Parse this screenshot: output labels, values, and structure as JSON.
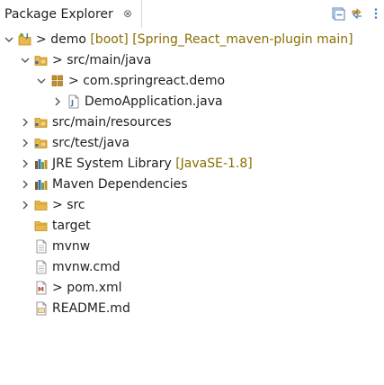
{
  "view": {
    "title": "Package Explorer",
    "close_glyph": "⊗",
    "toolbar": [
      {
        "name": "collapse-all-icon"
      },
      {
        "name": "link-with-editor-icon"
      },
      {
        "name": "view-menu-icon"
      }
    ]
  },
  "tree": {
    "rows": [
      {
        "prefix": "> ",
        "label": "demo",
        "decoration": " [boot] [Spring_React_maven-plugin main]",
        "expanded": true,
        "level": 0,
        "icon": "java-project-icon"
      },
      {
        "prefix": "> ",
        "label": "src/main/java",
        "decoration": "",
        "expanded": true,
        "level": 1,
        "icon": "source-folder-icon"
      },
      {
        "prefix": "> ",
        "label": "com.springreact.demo",
        "decoration": "",
        "expanded": true,
        "level": 2,
        "icon": "package-icon"
      },
      {
        "prefix": "",
        "label": "DemoApplication.java",
        "decoration": "",
        "expanded": false,
        "level": 3,
        "icon": "java-file-icon"
      },
      {
        "prefix": "",
        "label": "src/main/resources",
        "decoration": "",
        "expanded": false,
        "level": 1,
        "icon": "source-folder-icon"
      },
      {
        "prefix": "",
        "label": "src/test/java",
        "decoration": "",
        "expanded": false,
        "level": 1,
        "icon": "source-folder-icon"
      },
      {
        "prefix": "",
        "label": "JRE System Library",
        "decoration": " [JavaSE-1.8]",
        "expanded": false,
        "level": 1,
        "icon": "library-icon"
      },
      {
        "prefix": "",
        "label": "Maven Dependencies",
        "decoration": "",
        "expanded": false,
        "level": 1,
        "icon": "library-icon"
      },
      {
        "prefix": "> ",
        "label": "src",
        "decoration": "",
        "expanded": false,
        "level": 1,
        "icon": "folder-icon"
      },
      {
        "prefix": "",
        "label": "target",
        "decoration": "",
        "expanded": null,
        "level": 1,
        "icon": "folder-icon"
      },
      {
        "prefix": "",
        "label": "mvnw",
        "decoration": "",
        "expanded": null,
        "level": 1,
        "icon": "file-icon"
      },
      {
        "prefix": "",
        "label": "mvnw.cmd",
        "decoration": "",
        "expanded": null,
        "level": 1,
        "icon": "file-icon"
      },
      {
        "prefix": "> ",
        "label": "pom.xml",
        "decoration": "",
        "expanded": null,
        "level": 1,
        "icon": "xml-file-icon"
      },
      {
        "prefix": "",
        "label": "README.md",
        "decoration": "",
        "expanded": null,
        "level": 1,
        "icon": "markdown-file-icon"
      }
    ]
  },
  "colors": {
    "background": "#ffffff",
    "text": "#1f1f1f",
    "decoration": "#8a6d00",
    "folder": "#e8b84a",
    "folder_dark": "#c08a1e",
    "package": "#c58f22",
    "java_blue": "#3a6fb0",
    "tab_border": "#d9d9d9"
  }
}
